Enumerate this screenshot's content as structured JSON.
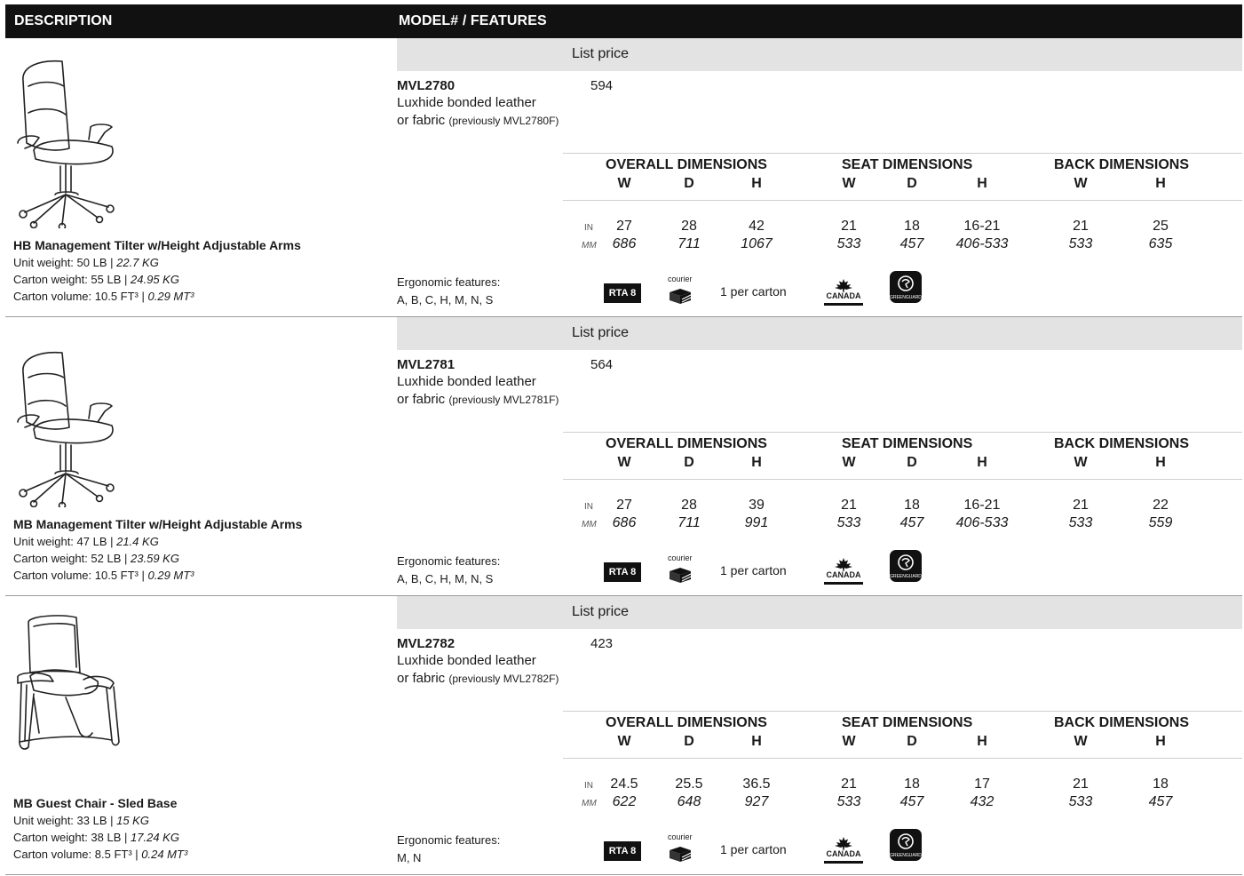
{
  "header": {
    "description": "DESCRIPTION",
    "model_features": "MODEL# / FEATURES"
  },
  "labels": {
    "list_price": "List price",
    "overall": "OVERALL DIMENSIONS",
    "seat": "SEAT DIMENSIONS",
    "back": "BACK DIMENSIONS",
    "w": "W",
    "d": "D",
    "h": "H",
    "in": "IN",
    "mm": "MM",
    "ergo_label": "Ergonomic features:",
    "rta": "RTA 8",
    "courier": "courier",
    "per_carton": "1 per carton",
    "canada": "CANADA",
    "greenguard": "GREENGUARD"
  },
  "products": [
    {
      "model": "MVL2780",
      "material_line1": "Luxhide bonded leather",
      "material_line2": "or fabric",
      "previously": "(previously MVL2780F)",
      "price": "594",
      "title": "HB Management Tilter w/Height Adjustable Arms",
      "unit_weight": "Unit weight: 50 LB | ",
      "unit_weight_metric": "22.7 KG",
      "carton_weight": "Carton weight: 55 LB | ",
      "carton_weight_metric": "24.95 KG",
      "carton_volume": "Carton volume: 10.5 FT³ | ",
      "carton_volume_metric": "0.29 MT³",
      "ergo": "A, B, C, H, M, N, S",
      "chair_icon": "high-back-office-chair",
      "in": [
        "27",
        "28",
        "42",
        "21",
        "18",
        "16-21",
        "21",
        "25"
      ],
      "mm": [
        "686",
        "711",
        "1067",
        "533",
        "457",
        "406-533",
        "533",
        "635"
      ]
    },
    {
      "model": "MVL2781",
      "material_line1": "Luxhide bonded leather",
      "material_line2": "or fabric",
      "previously": "(previously MVL2781F)",
      "price": "564",
      "title": "MB Management Tilter w/Height Adjustable Arms",
      "unit_weight": "Unit weight: 47 LB | ",
      "unit_weight_metric": "21.4 KG",
      "carton_weight": "Carton weight: 52 LB | ",
      "carton_weight_metric": "23.59 KG",
      "carton_volume": "Carton volume: 10.5 FT³ | ",
      "carton_volume_metric": "0.29 MT³",
      "ergo": "A, B, C, H, M, N, S",
      "chair_icon": "mid-back-office-chair",
      "in": [
        "27",
        "28",
        "39",
        "21",
        "18",
        "16-21",
        "21",
        "22"
      ],
      "mm": [
        "686",
        "711",
        "991",
        "533",
        "457",
        "406-533",
        "533",
        "559"
      ]
    },
    {
      "model": "MVL2782",
      "material_line1": "Luxhide bonded leather",
      "material_line2": "or fabric",
      "previously": "(previously MVL2782F)",
      "price": "423",
      "title": "MB Guest Chair - Sled Base",
      "unit_weight": "Unit weight: 33 LB | ",
      "unit_weight_metric": "15 KG",
      "carton_weight": "Carton weight: 38 LB | ",
      "carton_weight_metric": "17.24 KG",
      "carton_volume": "Carton volume: 8.5 FT³ | ",
      "carton_volume_metric": "0.24 MT³",
      "ergo": "M, N",
      "chair_icon": "sled-base-guest-chair",
      "in": [
        "24.5",
        "25.5",
        "36.5",
        "21",
        "18",
        "17",
        "21",
        "18"
      ],
      "mm": [
        "622",
        "648",
        "927",
        "533",
        "457",
        "432",
        "533",
        "457"
      ]
    }
  ]
}
